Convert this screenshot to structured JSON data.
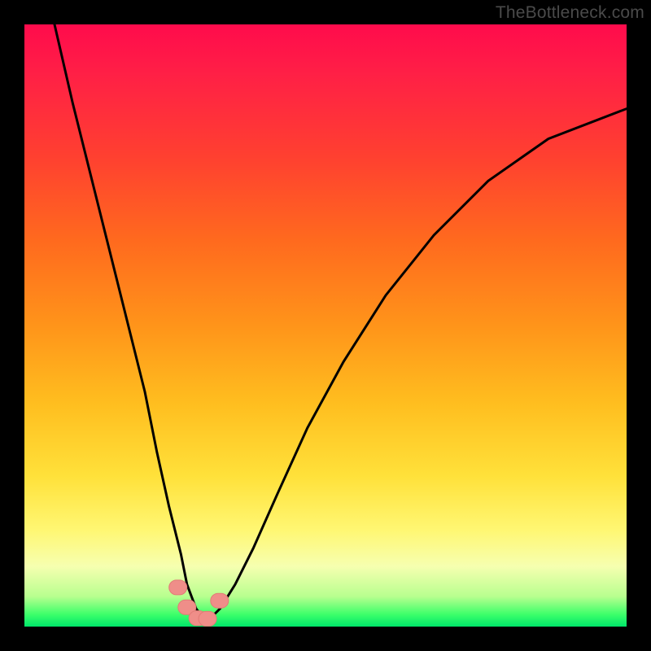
{
  "watermark": "TheBottleneck.com",
  "colors": {
    "curve_stroke": "#000000",
    "marker_fill": "#ef8e89",
    "marker_stroke": "#e27b76"
  },
  "chart_data": {
    "type": "line",
    "title": "",
    "xlabel": "",
    "ylabel": "",
    "xlim": [
      0,
      100
    ],
    "ylim": [
      0,
      100
    ],
    "series": [
      {
        "name": "bottleneck-curve",
        "x": [
          5,
          8,
          11,
          14,
          17,
          20,
          22,
          24,
          26,
          27,
          28.5,
          30,
          31,
          32.5,
          35,
          38,
          42,
          47,
          53,
          60,
          68,
          77,
          87,
          100
        ],
        "values": [
          100,
          87,
          75,
          63,
          51,
          39,
          29,
          20,
          12,
          7,
          3,
          1,
          1.5,
          3,
          7,
          13,
          22,
          33,
          44,
          55,
          65,
          74,
          81,
          86
        ]
      }
    ],
    "markers": [
      {
        "x": 25.5,
        "y": 6.5
      },
      {
        "x": 27.0,
        "y": 3.2
      },
      {
        "x": 28.8,
        "y": 1.4
      },
      {
        "x": 30.4,
        "y": 1.3
      },
      {
        "x": 32.4,
        "y": 4.3
      }
    ]
  }
}
